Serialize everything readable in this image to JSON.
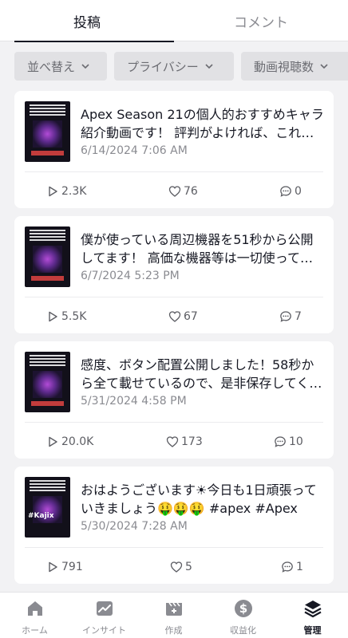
{
  "tabs": [
    {
      "label": "投稿",
      "active": true
    },
    {
      "label": "コメント",
      "active": false
    }
  ],
  "filters": [
    {
      "label": "並べ替え"
    },
    {
      "label": "プライバシー"
    },
    {
      "label": "動画視聴数"
    }
  ],
  "posts": [
    {
      "title": "Apex Season 21の個人的おすすめキャラ紹介動画です！ 評判がよければ、これからシリーズ化していきます",
      "date": "6/14/2024 7:06 AM",
      "views": "2.3K",
      "likes": "76",
      "comments": "0"
    },
    {
      "title": "僕が使っている周辺機器を51秒から公開してます！ 高価な機器等は一切使っていません",
      "date": "6/7/2024 5:23 PM",
      "views": "5.5K",
      "likes": "67",
      "comments": "7"
    },
    {
      "title": "感度、ボタン配置公開しました！58秒から全て載せているので、是非保存してください",
      "date": "5/31/2024 4:58 PM",
      "views": "20.0K",
      "likes": "173",
      "comments": "10"
    },
    {
      "title": "おはようございます☀今日も1日頑張っていきましょう🤑🤑🤑 #apex #Apex",
      "date": "5/30/2024 7:28 AM",
      "views": "791",
      "likes": "5",
      "comments": "1"
    }
  ],
  "thumb_logo": "#Kajix",
  "bottom_nav": [
    {
      "label": "ホーム",
      "icon": "home-icon",
      "active": false
    },
    {
      "label": "インサイト",
      "icon": "insights-icon",
      "active": false
    },
    {
      "label": "作成",
      "icon": "create-icon",
      "active": false
    },
    {
      "label": "収益化",
      "icon": "dollar-icon",
      "active": false
    },
    {
      "label": "管理",
      "icon": "layers-icon",
      "active": true
    }
  ],
  "colors": {
    "background": "#f2f2f4",
    "card": "#ffffff",
    "text_primary": "#161823",
    "text_secondary": "#8a8b91",
    "chip_bg": "#e1e1e4"
  }
}
